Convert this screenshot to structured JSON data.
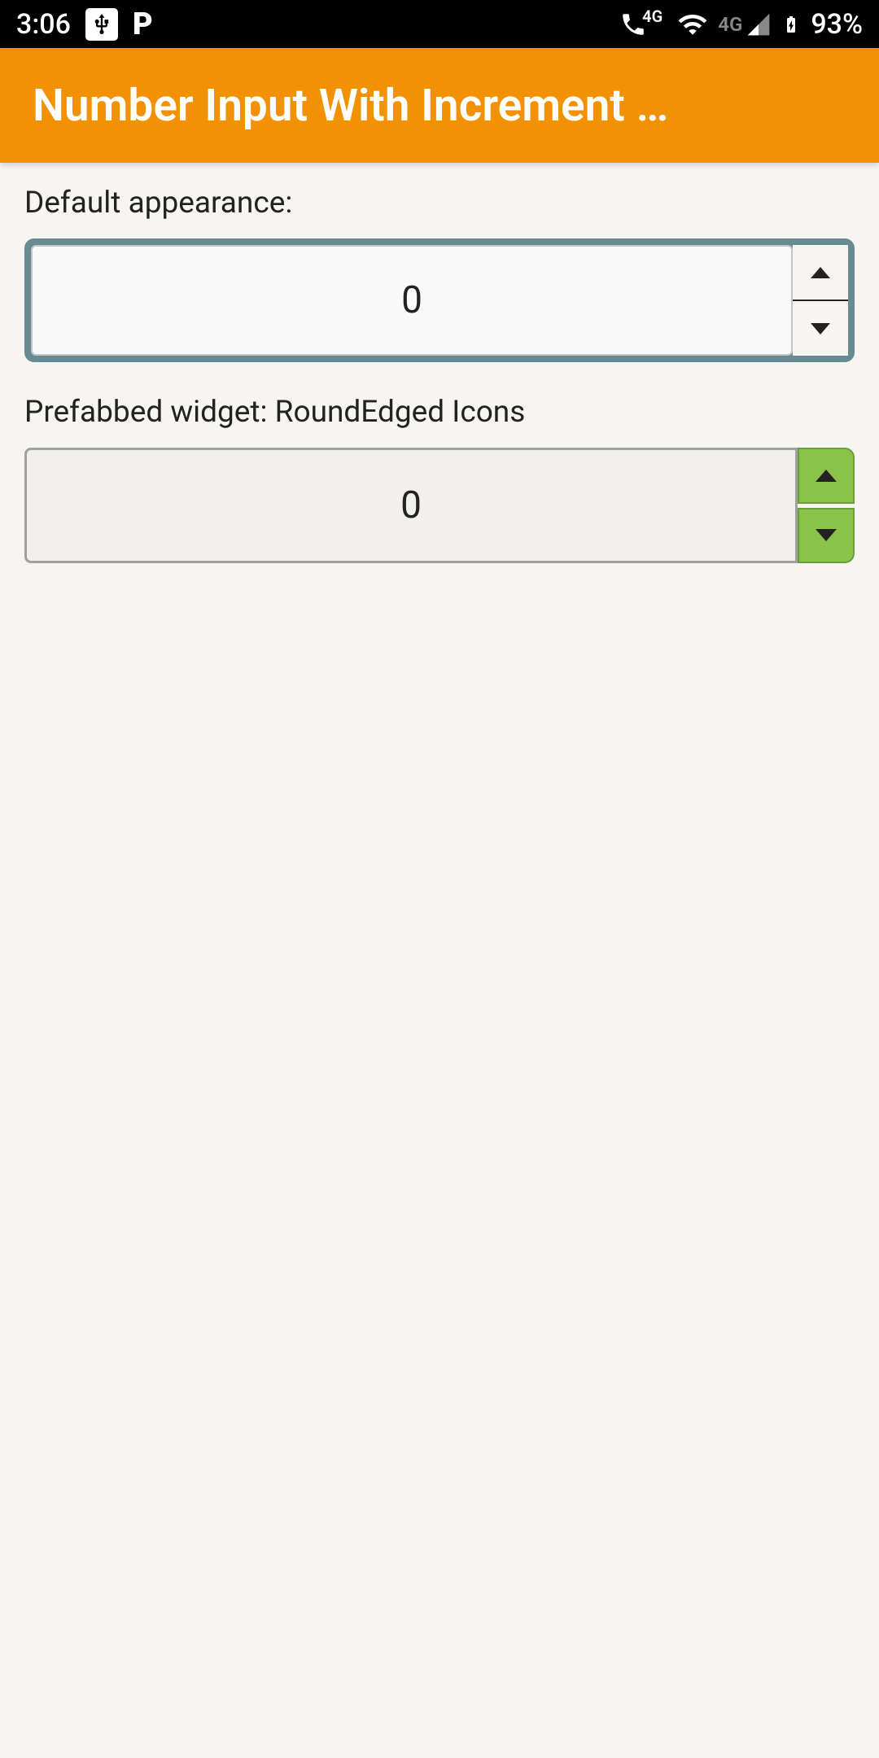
{
  "statusBar": {
    "time": "3:06",
    "batteryPercent": "93%",
    "network4g": "4G"
  },
  "appBar": {
    "title": "Number Input With Increment …"
  },
  "content": {
    "label1": "Default appearance:",
    "stepper1Value": "0",
    "label2": "Prefabbed widget: RoundEdged Icons",
    "stepper2Value": "0"
  }
}
